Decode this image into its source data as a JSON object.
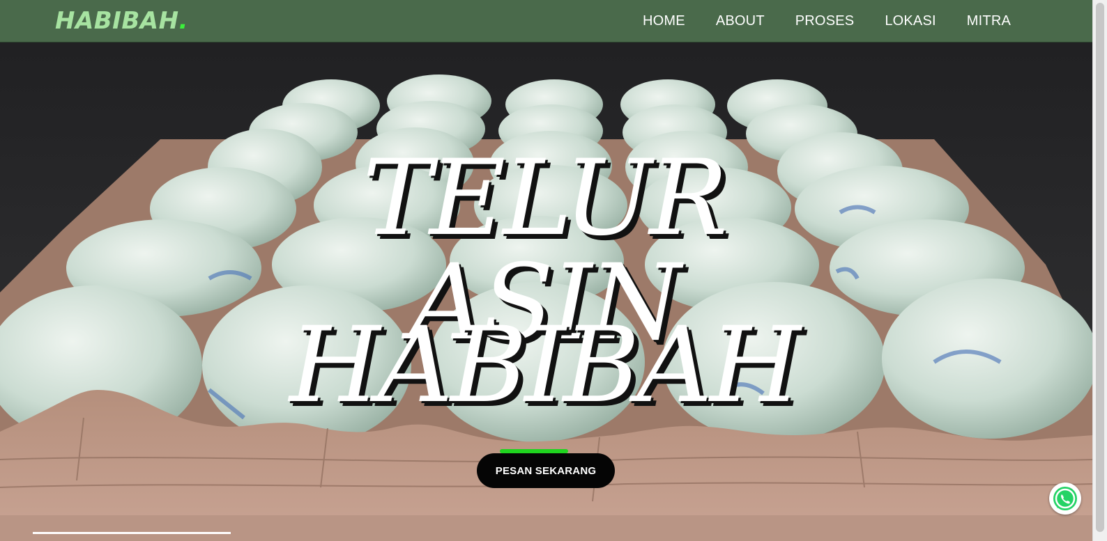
{
  "brand": {
    "name": "HABIBAH",
    "dot": "."
  },
  "nav": {
    "items": [
      {
        "label": "HOME"
      },
      {
        "label": "ABOUT"
      },
      {
        "label": "PROSES"
      },
      {
        "label": "LOKASI"
      },
      {
        "label": "MITRA"
      }
    ]
  },
  "hero": {
    "title_line1": "TELUR ASIN",
    "title_line2": "HABIBAH",
    "cta_label": "PESAN SEKARANG"
  },
  "icons": {
    "whatsapp": "whatsapp-icon"
  },
  "colors": {
    "navbar": "#4a6a4b",
    "logo": "#a7e3a1",
    "accent": "#3cf03c",
    "cta": "#050505",
    "whatsapp": "#25d366"
  }
}
